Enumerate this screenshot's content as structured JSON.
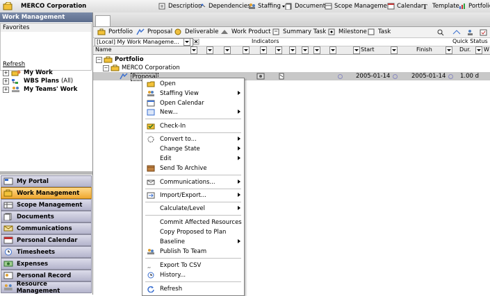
{
  "app": {
    "title": "MERCO Corporation"
  },
  "topnav": [
    {
      "label": "Description",
      "icon": "description-icon"
    },
    {
      "label": "Dependencies",
      "icon": "dependencies-icon"
    },
    {
      "label": "Staffing",
      "icon": "staffing-icon"
    },
    {
      "label": "Documents",
      "icon": "documents-icon"
    },
    {
      "label": "Scope Management",
      "icon": "scope-icon"
    },
    {
      "label": "Calendar",
      "icon": "calendar-icon"
    },
    {
      "label": "Template",
      "icon": "template-icon"
    },
    {
      "label": "Portfolio",
      "icon": "portfolio-icon"
    }
  ],
  "left": {
    "header": "Work Management",
    "favorites": "Favorites",
    "refresh": "Refresh",
    "tree": [
      {
        "label": "My Work",
        "extra": ""
      },
      {
        "label": "WBS Plans",
        "extra": "(All)"
      },
      {
        "label": "My Teams' Work",
        "extra": ""
      }
    ],
    "nav": [
      {
        "label": "My Portal",
        "icon": "portal-icon"
      },
      {
        "label": "Work Management",
        "icon": "work-management-icon"
      },
      {
        "label": "Scope Management",
        "icon": "scope-management-icon"
      },
      {
        "label": "Documents",
        "icon": "documents-icon"
      },
      {
        "label": "Communications",
        "icon": "communications-icon"
      },
      {
        "label": "Personal Calendar",
        "icon": "calendar-icon"
      },
      {
        "label": "Timesheets",
        "icon": "clock-icon"
      },
      {
        "label": "Expenses",
        "icon": "expenses-icon"
      },
      {
        "label": "Personal Record",
        "icon": "personal-record-icon"
      },
      {
        "label": "Resource Management",
        "icon": "resource-icon"
      }
    ]
  },
  "toolbar": [
    {
      "label": "Portfolio",
      "icon": "portfolio-icon"
    },
    {
      "label": "Proposal",
      "icon": "proposal-icon"
    },
    {
      "label": "Deliverable",
      "icon": "deliverable-icon"
    },
    {
      "label": "Work Product",
      "icon": "work-product-icon"
    },
    {
      "label": "Summary Task",
      "icon": "summary-task-icon"
    },
    {
      "label": "Milestone",
      "icon": "milestone-icon"
    },
    {
      "label": "Task",
      "icon": "task-icon"
    }
  ],
  "filter": {
    "value": "[Local] My Work Manageme..."
  },
  "columns": {
    "name": "Name",
    "indicators": "Indicators",
    "quick_status": "Quick Status",
    "start": "Start",
    "finish": "Finish",
    "duration": "Dur.",
    "w": "W"
  },
  "rows": [
    {
      "name": "Portfolio",
      "start": "",
      "finish": "",
      "dur": ""
    },
    {
      "name": "MERCO Corporation",
      "start": "",
      "finish": "",
      "dur": ""
    },
    {
      "name": "Proposal",
      "start": "2005-01-14",
      "finish": "2005-01-14",
      "dur": "1.00 d"
    }
  ],
  "context_menu": [
    {
      "label": "Open",
      "icon": "open-folder-icon",
      "sub": false
    },
    {
      "label": "Staffing View",
      "icon": "staffing-icon",
      "sub": true
    },
    {
      "label": "Open Calendar",
      "icon": "calendar-icon",
      "sub": false
    },
    {
      "label": "New...",
      "icon": "new-icon",
      "sub": true
    },
    {
      "label": "Check-In",
      "icon": "check-in-icon",
      "sub": false
    },
    {
      "label": "Convert to...",
      "icon": "convert-icon",
      "sub": true
    },
    {
      "label": "Change State",
      "icon": "",
      "sub": true
    },
    {
      "label": "Edit",
      "icon": "",
      "sub": true
    },
    {
      "label": "Send To Archive",
      "icon": "archive-icon",
      "sub": false
    },
    {
      "label": "Communications...",
      "icon": "communications-icon",
      "sub": true
    },
    {
      "label": "Import/Export...",
      "icon": "import-export-icon",
      "sub": true
    },
    {
      "label": "Calculate/Level",
      "icon": "",
      "sub": true
    },
    {
      "label": "Commit Affected Resources",
      "icon": "",
      "sub": false
    },
    {
      "label": "Copy Proposed to Plan",
      "icon": "",
      "sub": false
    },
    {
      "label": "Baseline",
      "icon": "",
      "sub": true
    },
    {
      "label": "Publish To Team",
      "icon": "publish-icon",
      "sub": false
    },
    {
      "label": "Export To CSV",
      "icon": "export-csv-icon",
      "sub": false
    },
    {
      "label": "History...",
      "icon": "history-icon",
      "sub": false
    },
    {
      "label": "Refresh",
      "icon": "refresh-icon",
      "sub": false
    }
  ]
}
